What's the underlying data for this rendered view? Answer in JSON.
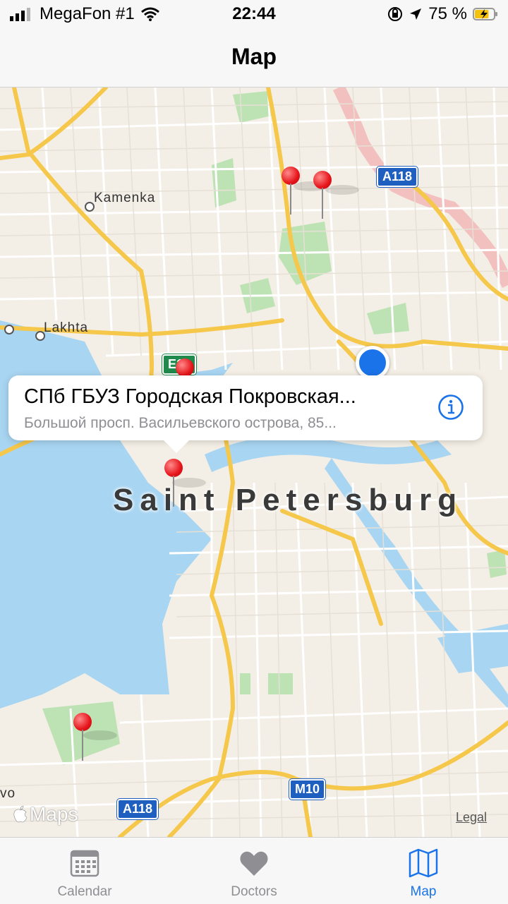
{
  "status_bar": {
    "carrier": "MegaFon #1",
    "time": "22:44",
    "battery_percent": "75 %",
    "battery_level": 0.75,
    "icons": [
      "signal-icon",
      "wifi-icon",
      "orientation-lock-icon",
      "location-arrow-icon",
      "battery-charging-icon"
    ]
  },
  "nav": {
    "title": "Map"
  },
  "map": {
    "places": {
      "kamenka": "Kamenka",
      "lakhta": "Lakhta",
      "vo": "vo"
    },
    "city": "Saint Petersburg",
    "shields": {
      "a118_top": "A118",
      "e18": "E18",
      "a118_bottom": "A118",
      "m10": "M10"
    },
    "attribution": "Maps",
    "legal": "Legal",
    "accent_color": "#1a73e8",
    "pin_color": "#e5141a"
  },
  "callout": {
    "title": "СПб ГБУЗ Городская Покровская...",
    "subtitle": "Большой просп. Васильевского острова, 85..."
  },
  "tabs": [
    {
      "label": "Calendar",
      "icon": "calendar-icon",
      "active": false
    },
    {
      "label": "Doctors",
      "icon": "heart-icon",
      "active": false
    },
    {
      "label": "Map",
      "icon": "map-icon",
      "active": true
    }
  ]
}
